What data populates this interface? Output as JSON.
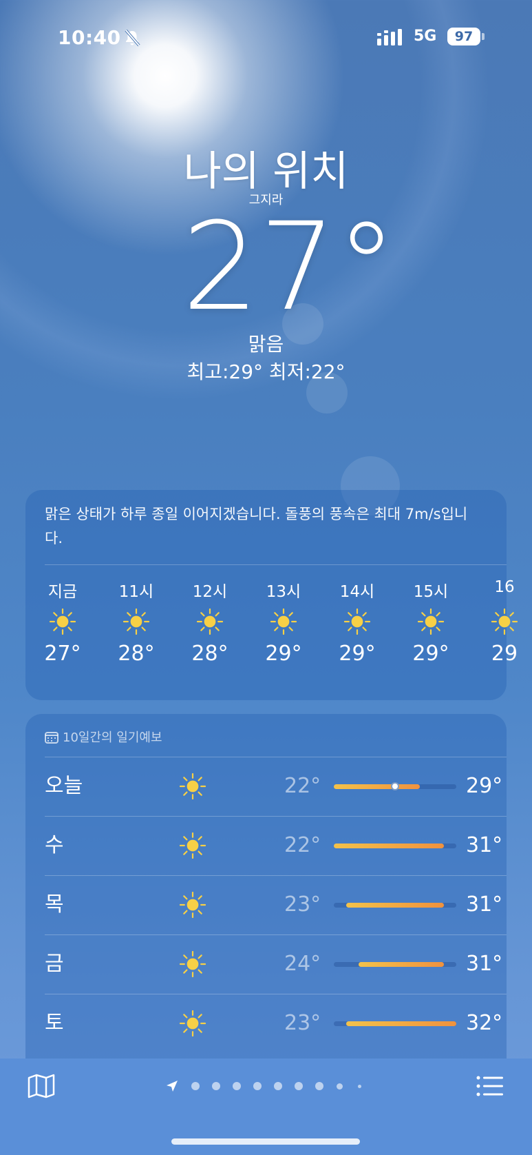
{
  "status": {
    "time": "10:40",
    "network": "5G",
    "battery": "97"
  },
  "hero": {
    "location": "나의 위치",
    "sublocation": "그지라",
    "temperature": "27°",
    "condition": "맑음",
    "high_low": "최고:29°  최저:22°"
  },
  "hourly": {
    "summary": "맑은 상태가 하루 종일 이어지겠습니다. 돌풍의 풍속은 최대 7m/s입니다.",
    "items": [
      {
        "label": "지금",
        "icon": "sun-icon",
        "temp": "27°"
      },
      {
        "label": "11시",
        "icon": "sun-icon",
        "temp": "28°"
      },
      {
        "label": "12시",
        "icon": "sun-icon",
        "temp": "28°"
      },
      {
        "label": "13시",
        "icon": "sun-icon",
        "temp": "29°"
      },
      {
        "label": "14시",
        "icon": "sun-icon",
        "temp": "29°"
      },
      {
        "label": "15시",
        "icon": "sun-icon",
        "temp": "29°"
      },
      {
        "label": "16",
        "icon": "sun-icon",
        "temp": "29"
      }
    ]
  },
  "forecast": {
    "header": "10일간의 일기예보",
    "scale": {
      "min": 22,
      "max": 32
    },
    "current_temp": 27,
    "days": [
      {
        "day": "오늘",
        "icon": "sun-icon",
        "lo": "22°",
        "hi": "29°",
        "lo_value": 22,
        "hi_value": 29
      },
      {
        "day": "수",
        "icon": "sun-icon",
        "lo": "22°",
        "hi": "31°",
        "lo_value": 22,
        "hi_value": 31
      },
      {
        "day": "목",
        "icon": "sun-icon",
        "lo": "23°",
        "hi": "31°",
        "lo_value": 23,
        "hi_value": 31
      },
      {
        "day": "금",
        "icon": "sun-icon",
        "lo": "24°",
        "hi": "31°",
        "lo_value": 24,
        "hi_value": 31
      },
      {
        "day": "토",
        "icon": "sun-icon",
        "lo": "23°",
        "hi": "32°",
        "lo_value": 23,
        "hi_value": 32
      }
    ]
  },
  "toolbar": {
    "map_icon": "map-icon",
    "list_icon": "list-icon",
    "location_arrow": "location-arrow-icon"
  },
  "colors": {
    "accent_bar_start": "#f3c24a",
    "accent_bar_end": "#f0923e",
    "sun": "#f7d046"
  }
}
